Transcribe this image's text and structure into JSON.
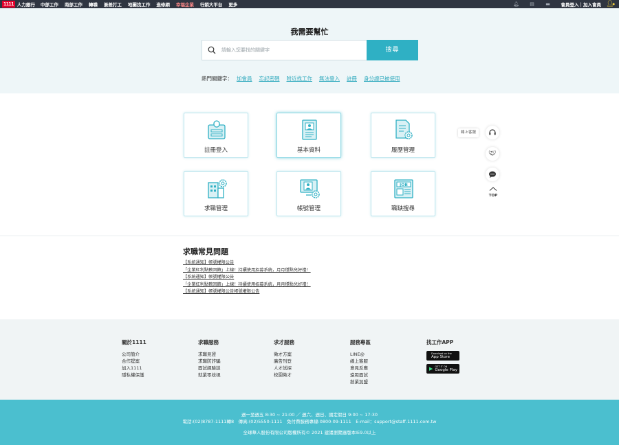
{
  "topnav": {
    "logo_mark": "1111",
    "logo_text": "人力銀行",
    "items": [
      "中部工作",
      "南部工作",
      "轉職",
      "兼差打工",
      "地圖找工作",
      "進修網",
      "幸福企業",
      "行銷大平台",
      "更多"
    ],
    "account": "會員登入｜加入會員",
    "accent_color": "#ff8a8a"
  },
  "hero": {
    "title": "我需要幫忙",
    "search_placeholder": "請輸入您要找的關鍵字",
    "search_button": "搜尋",
    "hot_label": "熱門關鍵字：",
    "hot_keywords": [
      "加會員",
      "忘記密碼",
      "附近找工作",
      "無法登入",
      "註冊",
      "身分證已被使用"
    ]
  },
  "services": [
    {
      "label": "註冊登入",
      "icon": "register-login-icon"
    },
    {
      "label": "基本資料",
      "icon": "profile-document-icon"
    },
    {
      "label": "履歷管理",
      "icon": "resume-gear-icon"
    },
    {
      "label": "求職管理",
      "icon": "job-search-building-icon"
    },
    {
      "label": "帳號管理",
      "icon": "account-monitor-icon"
    },
    {
      "label": "職缺搜尋",
      "icon": "job-newspaper-icon"
    }
  ],
  "float": {
    "tooltip": "線上客服",
    "top_label": "TOP"
  },
  "faq": {
    "title": "求職常見問題",
    "items": [
      "【系統通知】帳號權限公告",
      "「企業紅利點數回饋」上線！持續使用招募系統，月月穩點兒好禮！",
      "【系統通知】帳號權限公告",
      "「企業紅利點數回饋」上線！持續使用招募系統，月月穩點兒好禮！",
      "【系統通知】帳號權限公告帳號權限公告"
    ]
  },
  "footer": {
    "columns": [
      {
        "heading": "關於1111",
        "items": [
          "公司簡介",
          "合作提案",
          "加入1111",
          "隱私權保護"
        ]
      },
      {
        "heading": "求職服務",
        "items": [
          "求職見證",
          "求職防詐騙",
          "面試經驗談",
          "就業零歧視"
        ]
      },
      {
        "heading": "求才服務",
        "items": [
          "徵才方案",
          "廣告刊登",
          "人才試探",
          "校園徵才"
        ]
      },
      {
        "heading": "服務專區",
        "items": [
          "LINE@",
          "線上客服",
          "意見反應",
          "遠距面試",
          "創業加盟"
        ]
      }
    ],
    "app_heading": "找工作APP",
    "app_store": "App Store",
    "app_store_small": "Download on the",
    "google_play": "Google Play",
    "google_play_small": "GET IT ON"
  },
  "bottom": {
    "hours": "週一至週五 8:30 ~ 21:00 ／ 週六、週日、國定假日 9:00 ~ 17:30",
    "contact": "電話:(02)8787-1111轉8　傳真:(02)5550-1111　免付費服務專線:0800-09-1111　E-mail：support@staff.1111.com.tw",
    "copyright": "全球華人股份有限公司版權所有© 2021 建議瀏覽器版本IE9.0以上"
  },
  "colors": {
    "teal": "#2fb0c4",
    "footer_bar": "#4bbfcf",
    "nav_bg": "#2f3541"
  }
}
